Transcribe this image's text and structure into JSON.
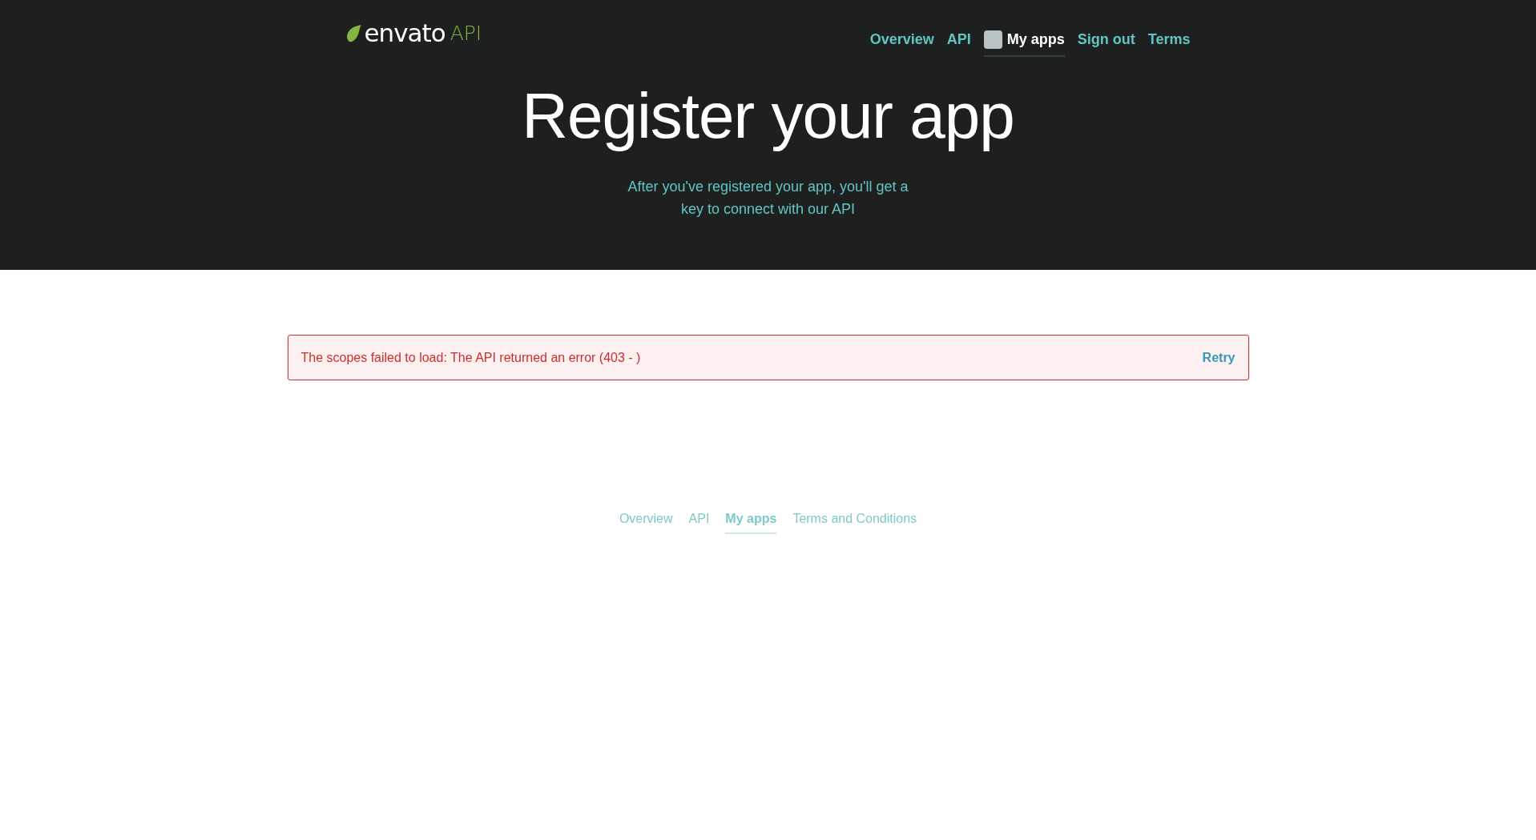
{
  "header": {
    "logo": {
      "brand": "envato",
      "product": "API"
    },
    "nav": [
      {
        "label": "Overview",
        "selected": false,
        "avatar": false
      },
      {
        "label": "API",
        "selected": false,
        "avatar": false
      },
      {
        "label": "My apps",
        "selected": true,
        "avatar": true
      },
      {
        "label": "Sign out",
        "selected": false,
        "avatar": false
      },
      {
        "label": "Terms",
        "selected": false,
        "avatar": false
      }
    ],
    "title": "Register your app",
    "subtitle": "After you've registered your app, you'll get a key to connect with our API"
  },
  "alert": {
    "message": "The scopes failed to load: The API returned an error (403 - )",
    "action": "Retry"
  },
  "footer": {
    "nav": [
      {
        "label": "Overview",
        "selected": false
      },
      {
        "label": "API",
        "selected": false
      },
      {
        "label": "My apps",
        "selected": true
      },
      {
        "label": "Terms and Conditions",
        "selected": false
      }
    ]
  }
}
